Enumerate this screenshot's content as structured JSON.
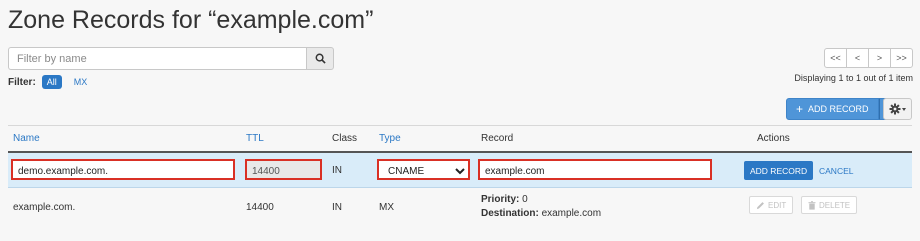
{
  "page": {
    "title": "Zone Records for “example.com”"
  },
  "search": {
    "placeholder": "Filter by name",
    "icon": "search-icon"
  },
  "filter": {
    "label": "Filter:",
    "options": [
      {
        "label": "All",
        "active": true
      },
      {
        "label": "MX",
        "active": false
      }
    ]
  },
  "pagination": {
    "first": "<<",
    "prev": "<",
    "next": ">",
    "last": ">>",
    "status": "Displaying 1 to 1 out of 1 item"
  },
  "toolbar": {
    "add_record": "ADD RECORD",
    "add_icon": "+",
    "settings_icon": "gear-icon"
  },
  "table": {
    "columns": {
      "name": "Name",
      "ttl": "TTL",
      "class": "Class",
      "type": "Type",
      "record": "Record",
      "actions": "Actions"
    },
    "edit_row": {
      "name": "demo.example.com.",
      "ttl": "14400",
      "class": "IN",
      "type": "CNAME",
      "record": "example.com",
      "save_label": "ADD RECORD",
      "cancel_label": "CANCEL"
    },
    "rows": [
      {
        "name": "example.com.",
        "ttl": "14400",
        "class": "IN",
        "type": "MX",
        "priority_label": "Priority:",
        "priority": "0",
        "destination_label": "Destination:",
        "destination": "example.com",
        "edit_label": "EDIT",
        "delete_label": "DELETE"
      }
    ]
  },
  "colors": {
    "accent": "#2b78c5",
    "highlight": "#d93025",
    "edit_row_bg": "#d9ecf9"
  }
}
